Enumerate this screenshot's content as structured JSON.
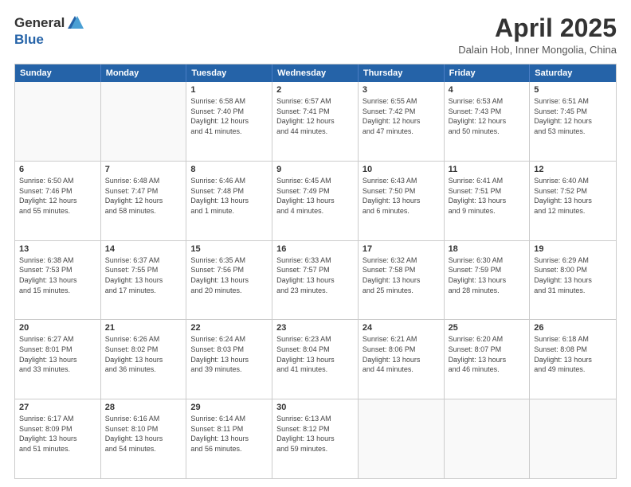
{
  "header": {
    "logo_general": "General",
    "logo_blue": "Blue",
    "month": "April 2025",
    "location": "Dalain Hob, Inner Mongolia, China"
  },
  "days_of_week": [
    "Sunday",
    "Monday",
    "Tuesday",
    "Wednesday",
    "Thursday",
    "Friday",
    "Saturday"
  ],
  "weeks": [
    [
      {
        "day": "",
        "text": ""
      },
      {
        "day": "",
        "text": ""
      },
      {
        "day": "1",
        "text": "Sunrise: 6:58 AM\nSunset: 7:40 PM\nDaylight: 12 hours\nand 41 minutes."
      },
      {
        "day": "2",
        "text": "Sunrise: 6:57 AM\nSunset: 7:41 PM\nDaylight: 12 hours\nand 44 minutes."
      },
      {
        "day": "3",
        "text": "Sunrise: 6:55 AM\nSunset: 7:42 PM\nDaylight: 12 hours\nand 47 minutes."
      },
      {
        "day": "4",
        "text": "Sunrise: 6:53 AM\nSunset: 7:43 PM\nDaylight: 12 hours\nand 50 minutes."
      },
      {
        "day": "5",
        "text": "Sunrise: 6:51 AM\nSunset: 7:45 PM\nDaylight: 12 hours\nand 53 minutes."
      }
    ],
    [
      {
        "day": "6",
        "text": "Sunrise: 6:50 AM\nSunset: 7:46 PM\nDaylight: 12 hours\nand 55 minutes."
      },
      {
        "day": "7",
        "text": "Sunrise: 6:48 AM\nSunset: 7:47 PM\nDaylight: 12 hours\nand 58 minutes."
      },
      {
        "day": "8",
        "text": "Sunrise: 6:46 AM\nSunset: 7:48 PM\nDaylight: 13 hours\nand 1 minute."
      },
      {
        "day": "9",
        "text": "Sunrise: 6:45 AM\nSunset: 7:49 PM\nDaylight: 13 hours\nand 4 minutes."
      },
      {
        "day": "10",
        "text": "Sunrise: 6:43 AM\nSunset: 7:50 PM\nDaylight: 13 hours\nand 6 minutes."
      },
      {
        "day": "11",
        "text": "Sunrise: 6:41 AM\nSunset: 7:51 PM\nDaylight: 13 hours\nand 9 minutes."
      },
      {
        "day": "12",
        "text": "Sunrise: 6:40 AM\nSunset: 7:52 PM\nDaylight: 13 hours\nand 12 minutes."
      }
    ],
    [
      {
        "day": "13",
        "text": "Sunrise: 6:38 AM\nSunset: 7:53 PM\nDaylight: 13 hours\nand 15 minutes."
      },
      {
        "day": "14",
        "text": "Sunrise: 6:37 AM\nSunset: 7:55 PM\nDaylight: 13 hours\nand 17 minutes."
      },
      {
        "day": "15",
        "text": "Sunrise: 6:35 AM\nSunset: 7:56 PM\nDaylight: 13 hours\nand 20 minutes."
      },
      {
        "day": "16",
        "text": "Sunrise: 6:33 AM\nSunset: 7:57 PM\nDaylight: 13 hours\nand 23 minutes."
      },
      {
        "day": "17",
        "text": "Sunrise: 6:32 AM\nSunset: 7:58 PM\nDaylight: 13 hours\nand 25 minutes."
      },
      {
        "day": "18",
        "text": "Sunrise: 6:30 AM\nSunset: 7:59 PM\nDaylight: 13 hours\nand 28 minutes."
      },
      {
        "day": "19",
        "text": "Sunrise: 6:29 AM\nSunset: 8:00 PM\nDaylight: 13 hours\nand 31 minutes."
      }
    ],
    [
      {
        "day": "20",
        "text": "Sunrise: 6:27 AM\nSunset: 8:01 PM\nDaylight: 13 hours\nand 33 minutes."
      },
      {
        "day": "21",
        "text": "Sunrise: 6:26 AM\nSunset: 8:02 PM\nDaylight: 13 hours\nand 36 minutes."
      },
      {
        "day": "22",
        "text": "Sunrise: 6:24 AM\nSunset: 8:03 PM\nDaylight: 13 hours\nand 39 minutes."
      },
      {
        "day": "23",
        "text": "Sunrise: 6:23 AM\nSunset: 8:04 PM\nDaylight: 13 hours\nand 41 minutes."
      },
      {
        "day": "24",
        "text": "Sunrise: 6:21 AM\nSunset: 8:06 PM\nDaylight: 13 hours\nand 44 minutes."
      },
      {
        "day": "25",
        "text": "Sunrise: 6:20 AM\nSunset: 8:07 PM\nDaylight: 13 hours\nand 46 minutes."
      },
      {
        "day": "26",
        "text": "Sunrise: 6:18 AM\nSunset: 8:08 PM\nDaylight: 13 hours\nand 49 minutes."
      }
    ],
    [
      {
        "day": "27",
        "text": "Sunrise: 6:17 AM\nSunset: 8:09 PM\nDaylight: 13 hours\nand 51 minutes."
      },
      {
        "day": "28",
        "text": "Sunrise: 6:16 AM\nSunset: 8:10 PM\nDaylight: 13 hours\nand 54 minutes."
      },
      {
        "day": "29",
        "text": "Sunrise: 6:14 AM\nSunset: 8:11 PM\nDaylight: 13 hours\nand 56 minutes."
      },
      {
        "day": "30",
        "text": "Sunrise: 6:13 AM\nSunset: 8:12 PM\nDaylight: 13 hours\nand 59 minutes."
      },
      {
        "day": "",
        "text": ""
      },
      {
        "day": "",
        "text": ""
      },
      {
        "day": "",
        "text": ""
      }
    ]
  ]
}
